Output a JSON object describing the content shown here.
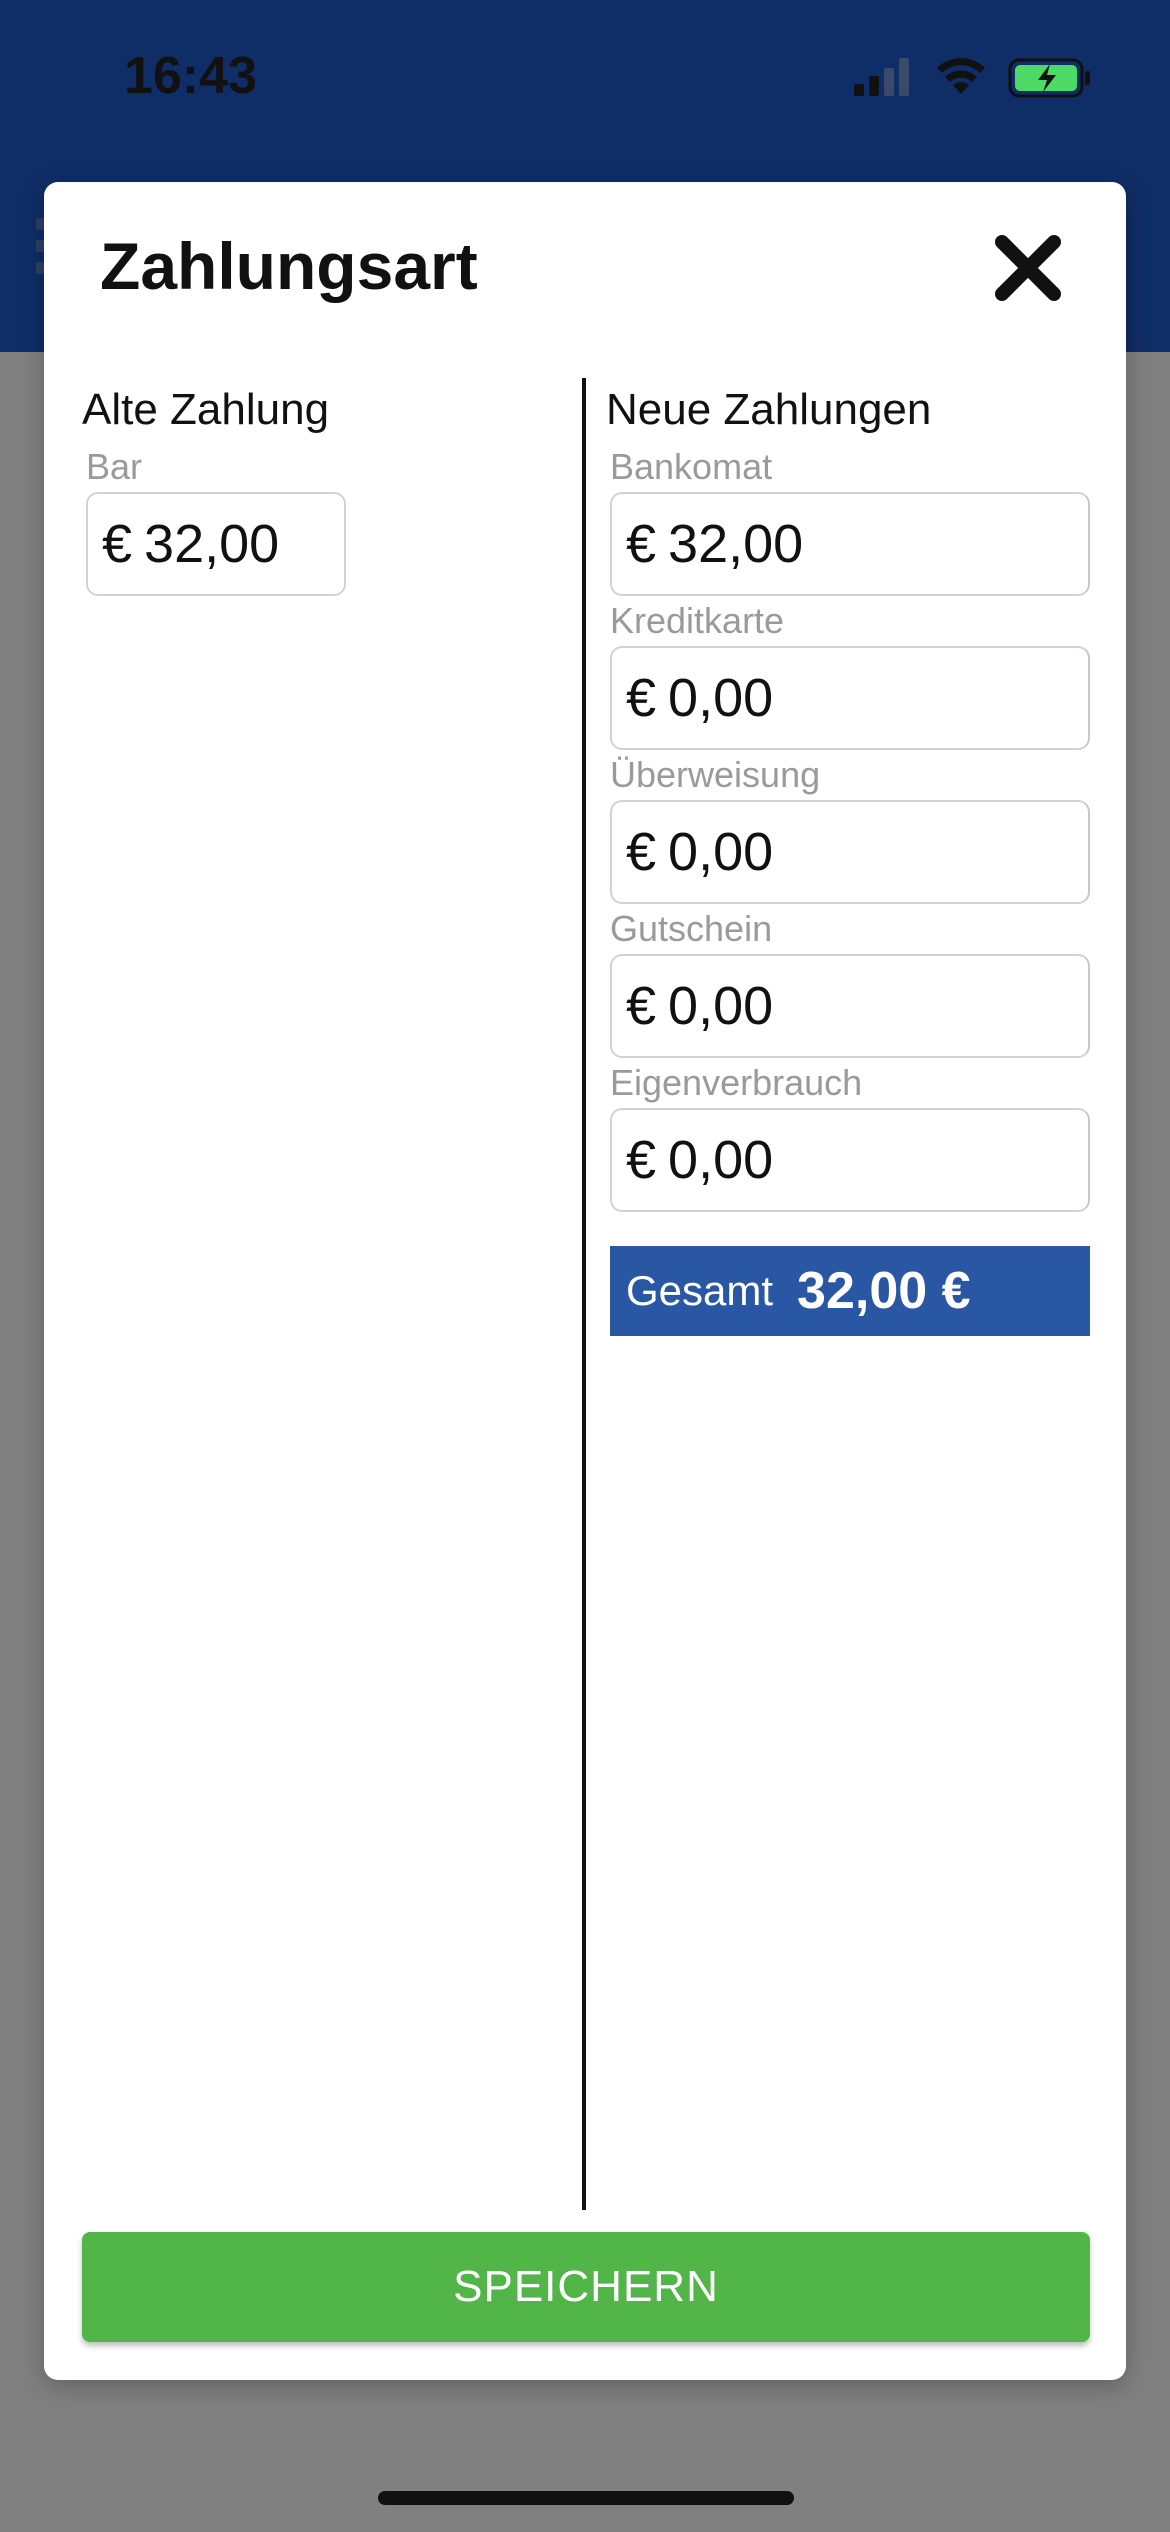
{
  "status_bar": {
    "time": "16:43"
  },
  "modal": {
    "title": "Zahlungsart",
    "close_icon": "close-icon"
  },
  "old_payment": {
    "heading": "Alte Zahlung",
    "method_label": "Bar",
    "currency": "€",
    "amount": "32,00"
  },
  "new_payments": {
    "heading": "Neue Zahlungen",
    "currency": "€",
    "items": [
      {
        "label": "Bankomat",
        "amount": "32,00"
      },
      {
        "label": "Kreditkarte",
        "amount": "0,00"
      },
      {
        "label": "Überweisung",
        "amount": "0,00"
      },
      {
        "label": "Gutschein",
        "amount": "0,00"
      },
      {
        "label": "Eigenverbrauch",
        "amount": "0,00"
      }
    ]
  },
  "total": {
    "label": "Gesamt",
    "value": "32,00 €"
  },
  "actions": {
    "save_label": "SPEICHERN"
  },
  "colors": {
    "header": "#0f2d66",
    "total_bar": "#2957a4",
    "save_button": "#52b548",
    "overlay": "#808080"
  }
}
